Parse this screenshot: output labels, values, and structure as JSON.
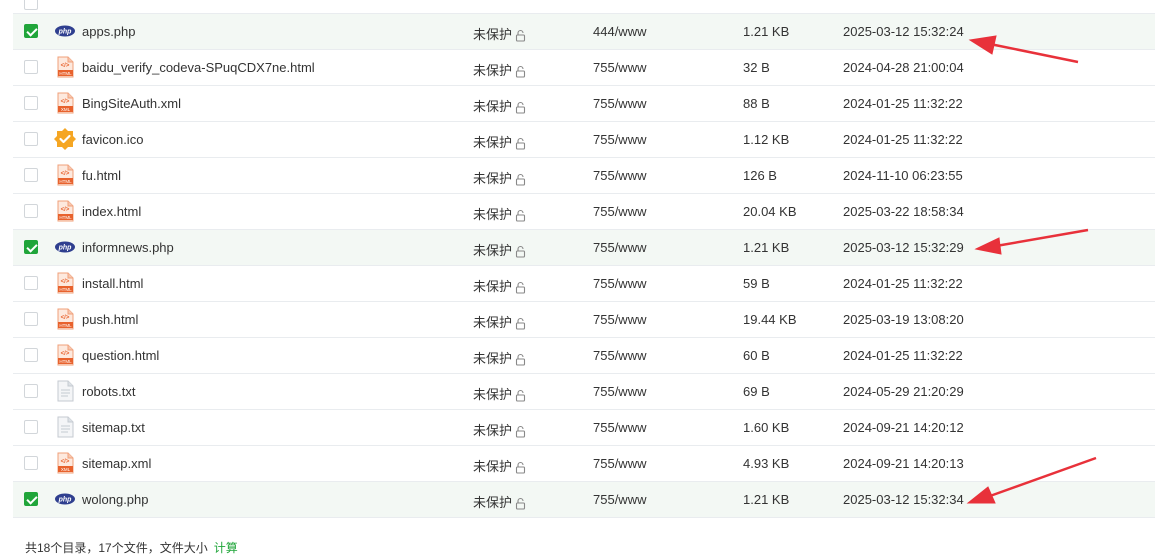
{
  "files": [
    {
      "name": "apps.php",
      "type": "php",
      "protection": "未保护",
      "permission": "444/www",
      "size": "1.21 KB",
      "modified": "2025-03-12 15:32:24",
      "checked": true
    },
    {
      "name": "baidu_verify_codeva-SPuqCDX7ne.html",
      "type": "html",
      "protection": "未保护",
      "permission": "755/www",
      "size": "32 B",
      "modified": "2024-04-28 21:00:04",
      "checked": false
    },
    {
      "name": "BingSiteAuth.xml",
      "type": "xml",
      "protection": "未保护",
      "permission": "755/www",
      "size": "88 B",
      "modified": "2024-01-25 11:32:22",
      "checked": false
    },
    {
      "name": "favicon.ico",
      "type": "ico",
      "protection": "未保护",
      "permission": "755/www",
      "size": "1.12 KB",
      "modified": "2024-01-25 11:32:22",
      "checked": false
    },
    {
      "name": "fu.html",
      "type": "html",
      "protection": "未保护",
      "permission": "755/www",
      "size": "126 B",
      "modified": "2024-11-10 06:23:55",
      "checked": false
    },
    {
      "name": "index.html",
      "type": "html",
      "protection": "未保护",
      "permission": "755/www",
      "size": "20.04 KB",
      "modified": "2025-03-22 18:58:34",
      "checked": false
    },
    {
      "name": "informnews.php",
      "type": "php",
      "protection": "未保护",
      "permission": "755/www",
      "size": "1.21 KB",
      "modified": "2025-03-12 15:32:29",
      "checked": true
    },
    {
      "name": "install.html",
      "type": "html",
      "protection": "未保护",
      "permission": "755/www",
      "size": "59 B",
      "modified": "2024-01-25 11:32:22",
      "checked": false
    },
    {
      "name": "push.html",
      "type": "html",
      "protection": "未保护",
      "permission": "755/www",
      "size": "19.44 KB",
      "modified": "2025-03-19 13:08:20",
      "checked": false
    },
    {
      "name": "question.html",
      "type": "html",
      "protection": "未保护",
      "permission": "755/www",
      "size": "60 B",
      "modified": "2024-01-25 11:32:22",
      "checked": false
    },
    {
      "name": "robots.txt",
      "type": "txt",
      "protection": "未保护",
      "permission": "755/www",
      "size": "69 B",
      "modified": "2024-05-29 21:20:29",
      "checked": false
    },
    {
      "name": "sitemap.txt",
      "type": "txt",
      "protection": "未保护",
      "permission": "755/www",
      "size": "1.60 KB",
      "modified": "2024-09-21 14:20:12",
      "checked": false
    },
    {
      "name": "sitemap.xml",
      "type": "xml",
      "protection": "未保护",
      "permission": "755/www",
      "size": "4.93 KB",
      "modified": "2024-09-21 14:20:13",
      "checked": false
    },
    {
      "name": "wolong.php",
      "type": "php",
      "protection": "未保护",
      "permission": "755/www",
      "size": "1.21 KB",
      "modified": "2025-03-12 15:32:34",
      "checked": true
    }
  ],
  "footer": {
    "summary": "共18个目录，17个文件，文件大小",
    "calc_label": "计算"
  },
  "colors": {
    "accent": "#20a53a",
    "selected_row": "#f3f8f4",
    "arrow": "#e8313a"
  },
  "icons": {
    "php": "php-file-icon",
    "html": "html-file-icon",
    "xml": "xml-file-icon",
    "ico": "image-file-icon",
    "txt": "text-file-icon",
    "lock": "lock-icon"
  }
}
